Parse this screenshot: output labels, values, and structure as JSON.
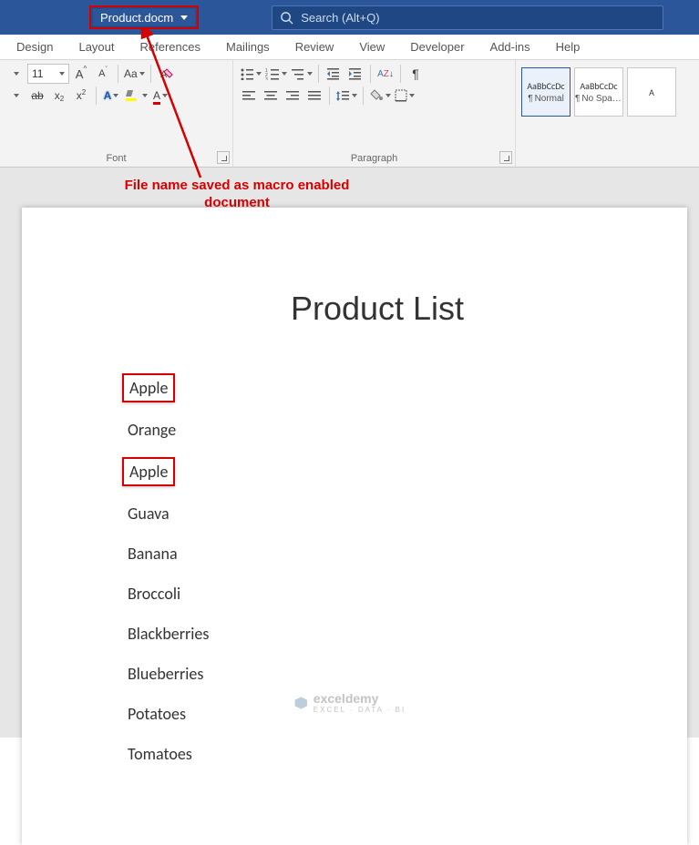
{
  "title_bar": {
    "filename": "Product.docm",
    "search_placeholder": "Search (Alt+Q)"
  },
  "ribbon_tabs": [
    "Design",
    "Layout",
    "References",
    "Mailings",
    "Review",
    "View",
    "Developer",
    "Add-ins",
    "Help"
  ],
  "font_group": {
    "label": "Font",
    "size_value": "11"
  },
  "paragraph_group": {
    "label": "Paragraph"
  },
  "styles_group": {
    "items": [
      {
        "sample": "AaBbCcDc",
        "label": "Normal"
      },
      {
        "sample": "AaBbCcDc",
        "label": "No Spac..."
      },
      {
        "sample": "A",
        "label": ""
      }
    ]
  },
  "annotation": {
    "line1": "File name saved as macro enabled",
    "line2": "document"
  },
  "document": {
    "title": "Product List",
    "products": [
      "Apple",
      "Orange",
      "Apple",
      "Guava",
      "Banana",
      "Broccoli",
      "Blackberries",
      "Blueberries",
      "Potatoes",
      "Tomatoes"
    ],
    "highlighted_indices": [
      0,
      2
    ]
  },
  "watermark": {
    "brand": "exceldemy",
    "tag": "EXCEL · DATA · BI"
  }
}
